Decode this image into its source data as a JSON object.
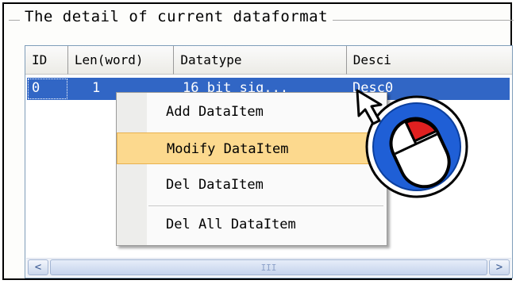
{
  "group": {
    "title": "The detail of current dataformat"
  },
  "table": {
    "columns": [
      "ID",
      "Len(word)",
      "Datatype",
      "Desci"
    ],
    "rows": [
      {
        "id": "0",
        "len": "1",
        "datatype": "16 bit sig...",
        "desc": "Desc0"
      }
    ]
  },
  "context_menu": {
    "items": [
      "Add DataItem",
      "Modify DataItem",
      "Del DataItem",
      "Del All DataItem"
    ],
    "highlighted": "Modify DataItem"
  },
  "scrollbar": {
    "left_arrow": "<",
    "right_arrow": ">",
    "thumb_grip": "III"
  },
  "colors": {
    "selection": "#3166c5",
    "menu_highlight": "#fcd98e",
    "mouse_badge": "#1f5fd6",
    "mouse_button": "#e02020"
  },
  "icons": [
    "mouse-right-click-icon",
    "cursor-arrow-icon"
  ]
}
